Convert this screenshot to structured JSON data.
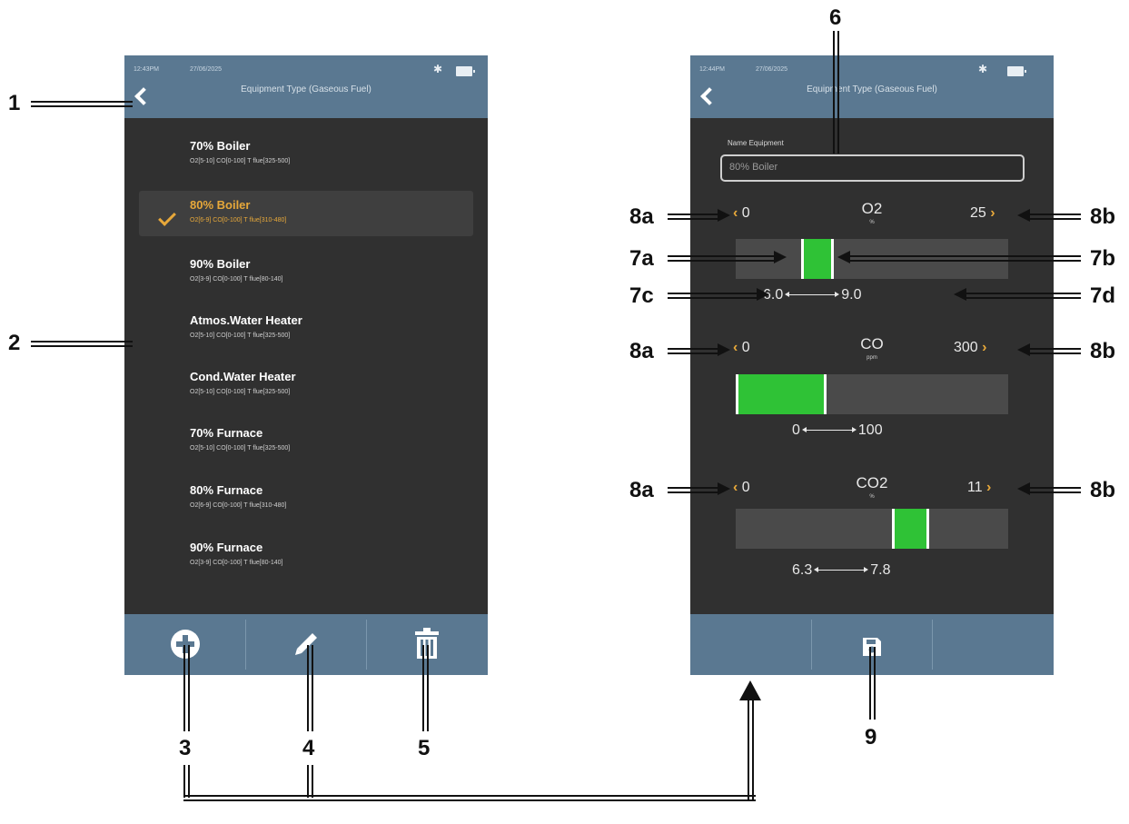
{
  "callouts": {
    "c1": "1",
    "c2": "2",
    "c3": "3",
    "c4": "4",
    "c5": "5",
    "c6": "6",
    "c7a": "7a",
    "c7b": "7b",
    "c7c": "7c",
    "c7d": "7d",
    "c8a": "8a",
    "c8b": "8b",
    "c9": "9"
  },
  "left_screen": {
    "status_time": "12:43PM",
    "status_date": "27/06/2025",
    "title": "Equipment Type (Gaseous Fuel)",
    "items": [
      {
        "name": "70% Boiler",
        "desc": "O2[5-10] CO[0-100] T flue[325-500]"
      },
      {
        "name": "80% Boiler",
        "desc": "O2[6-9] CO[0-100] T flue[310-480]",
        "selected": true
      },
      {
        "name": "90% Boiler",
        "desc": "O2[3-9] CO[0-100] T flue[80-140]"
      },
      {
        "name": "Atmos.Water Heater",
        "desc": "O2[5-10] CO[0-100] T flue[325-500]"
      },
      {
        "name": "Cond.Water Heater",
        "desc": "O2[5-10] CO[0-100] T flue[325-500]"
      },
      {
        "name": "70% Furnace",
        "desc": "O2[5-10] CO[0-100] T flue[325-500]"
      },
      {
        "name": "80% Furnace",
        "desc": "O2[6-9] CO[0-100] T flue[310-480]"
      },
      {
        "name": "90% Furnace",
        "desc": "O2[3-9] CO[0-100] T flue[80-140]"
      }
    ],
    "toolbar_icons": [
      "add-icon",
      "edit-icon",
      "delete-icon"
    ]
  },
  "right_screen": {
    "status_time": "12:44PM",
    "status_date": "27/06/2025",
    "title": "Equipment Type (Gaseous Fuel)",
    "name_label": "Name Equipment",
    "name_value": "80% Boiler",
    "params": [
      {
        "name": "O2",
        "unit": "%",
        "min": "0",
        "max": "25",
        "low": "6.0",
        "high": "9.0",
        "low_value": 6.0,
        "high_value": 9.0,
        "scale_max": 25
      },
      {
        "name": "CO",
        "unit": "ppm",
        "min": "0",
        "max": "300",
        "low": "0",
        "high": "100",
        "low_value": 0,
        "high_value": 100,
        "scale_max": 300
      },
      {
        "name": "CO2",
        "unit": "%",
        "min": "0",
        "max": "11",
        "low": "6.3",
        "high": "7.8",
        "low_value": 6.3,
        "high_value": 7.8,
        "scale_max": 11
      }
    ],
    "toolbar_icons": [
      "save-icon"
    ]
  },
  "colors": {
    "header": "#5a7891",
    "screen_bg": "#303030",
    "accent": "#e7a83a",
    "band": "#2fc236"
  }
}
